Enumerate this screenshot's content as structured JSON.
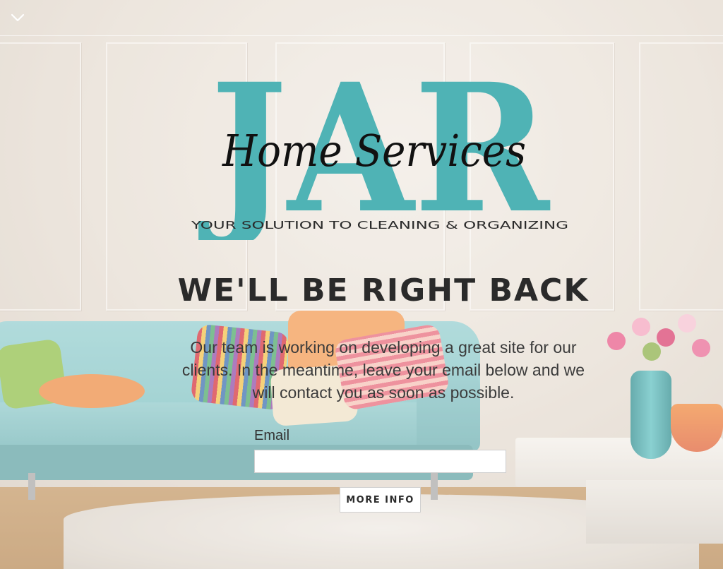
{
  "header": {
    "menu_icon": "chevron-down-icon"
  },
  "logo": {
    "monogram": "JAR",
    "script": "Home Services",
    "tagline": "YOUR SOLUTION TO CLEANING & ORGANIZING",
    "monogram_color": "#4fb3b5",
    "script_color": "#111111"
  },
  "main": {
    "headline": "WE'LL BE RIGHT BACK",
    "message": "Our team is working on developing a great site for our clients. In the meantime, leave your email below and we will contact you as soon as possible."
  },
  "form": {
    "email_label": "Email",
    "email_value": "",
    "email_placeholder": "",
    "submit_label": "MORE INFO"
  }
}
